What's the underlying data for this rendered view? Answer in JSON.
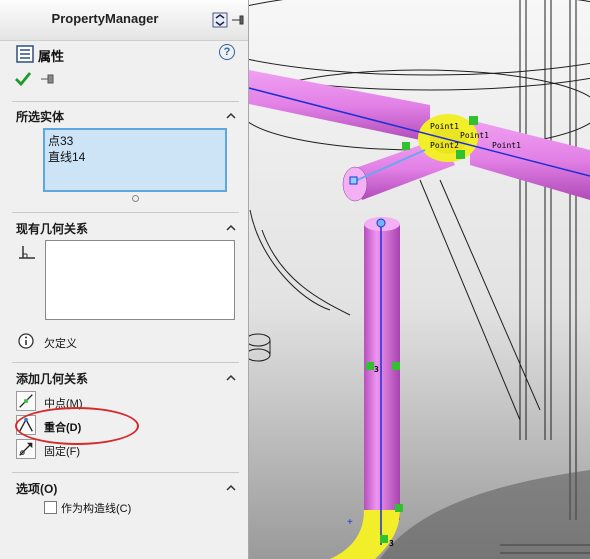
{
  "panel": {
    "title": "PropertyManager",
    "property_label": "属性",
    "help": "?",
    "selected_entities": {
      "title": "所选实体",
      "items": [
        "点33",
        "直线14"
      ]
    },
    "existing_relations": {
      "title": "现有几何关系",
      "status": "欠定义"
    },
    "add_relations": {
      "title": "添加几何关系",
      "items": [
        {
          "label": "中点(M)",
          "icon": "midpoint-icon"
        },
        {
          "label": "重合(D)",
          "icon": "coincident-icon"
        },
        {
          "label": "固定(F)",
          "icon": "fix-icon"
        }
      ]
    },
    "options": {
      "title": "选项(O)",
      "construction_label": "作为构造线(C)",
      "construction_checked": false
    }
  },
  "viewport": {
    "labels": [
      "Point1",
      "Point1",
      "Point1",
      "Point2"
    ],
    "dim_marks": [
      "3",
      "3"
    ],
    "pipe_color": "#e37fe6",
    "sketch_color": "#1e2fd6",
    "highlight_color": "#f2ee2a"
  }
}
